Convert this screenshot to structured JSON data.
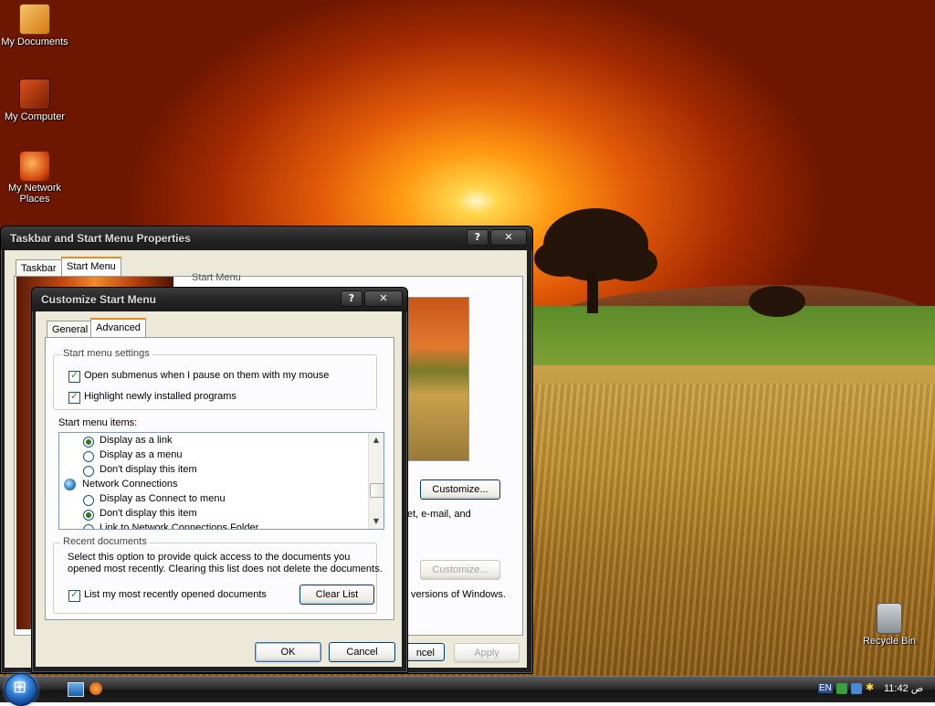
{
  "desktop": {
    "icons": [
      {
        "label": "My Documents",
        "icon": "my-documents-icon"
      },
      {
        "label": "My Computer",
        "icon": "my-computer-icon"
      },
      {
        "label": "My Network Places",
        "icon": "network-places-icon"
      },
      {
        "label": "Recycle Bin",
        "icon": "recycle-bin-icon"
      }
    ]
  },
  "back_window": {
    "title": "Taskbar and Start Menu Properties",
    "help_btn": "?",
    "close_btn": "✕",
    "tabs": [
      "Taskbar",
      "Start Menu"
    ],
    "partial_texts": {
      "start_menu_radio": "Start Menu",
      "customize1": "Customize...",
      "desc_tail": "et, e-mail, and",
      "customize2": "Customize...",
      "versions_tail": "versions of Windows."
    },
    "buttons": {
      "cancel_tail": "ncel",
      "apply": "Apply"
    }
  },
  "front_window": {
    "title": "Customize Start Menu",
    "help_btn": "?",
    "close_btn": "✕",
    "tabs": [
      "General",
      "Advanced"
    ],
    "settings_group": {
      "label": "Start menu settings",
      "options": [
        {
          "label": "Open submenus when I pause on them with my mouse",
          "checked": true
        },
        {
          "label": "Highlight newly installed programs",
          "checked": true
        }
      ]
    },
    "items_label": "Start menu items:",
    "items": [
      {
        "kind": "radio",
        "label": "Display as a link",
        "selected": true
      },
      {
        "kind": "radio",
        "label": "Display as a menu",
        "selected": false
      },
      {
        "kind": "radio",
        "label": "Don't display this item",
        "selected": false
      },
      {
        "kind": "header",
        "label": "Network Connections",
        "icon": "network-connections-icon"
      },
      {
        "kind": "radio",
        "label": "Display as Connect to menu",
        "selected": false
      },
      {
        "kind": "radio",
        "label": "Don't display this item",
        "selected": true
      },
      {
        "kind": "radio",
        "label": "Link to Network Connections Folder",
        "selected": false
      }
    ],
    "recent_group": {
      "label": "Recent documents",
      "description_line1": "Select this option to provide quick access to the documents you",
      "description_line2": "opened most recently.  Clearing this list does not delete the documents.",
      "checkbox_label": "List my most recently opened documents",
      "checked": true,
      "clear_button": "Clear List"
    },
    "buttons": {
      "ok": "OK",
      "cancel": "Cancel"
    }
  },
  "taskbar": {
    "tray": {
      "language": "EN",
      "time": "11:42 ص"
    }
  }
}
